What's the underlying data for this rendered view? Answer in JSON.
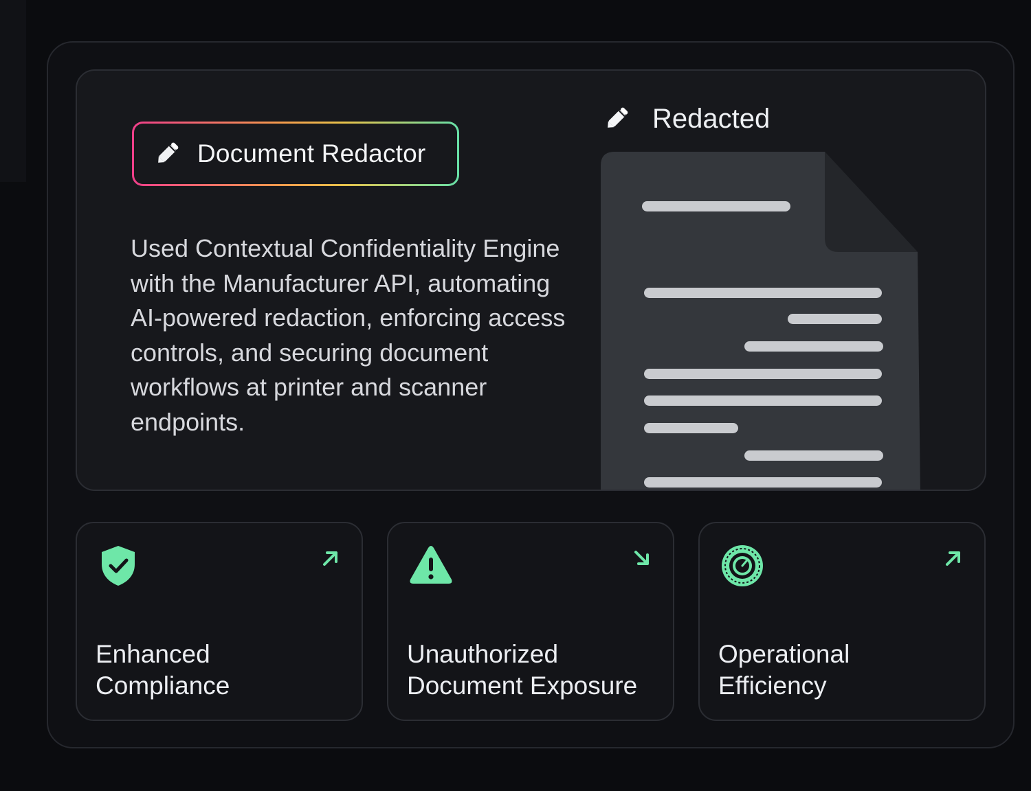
{
  "colors": {
    "background": "#0b0c0f",
    "panel": "#17181c",
    "accent_green": "#6ee7a8",
    "badge_gradient": [
      "#ef3f8a",
      "#f59a4c",
      "#e7c24b",
      "#67e0a8"
    ],
    "document": "#34373c",
    "redaction_bar": "#c9cbcf"
  },
  "hero": {
    "badge": {
      "icon": "pencil-icon",
      "label": "Document Redactor"
    },
    "description": "Used Contextual Confidentiality Engine with the Manufacturer API, automating AI-powered redaction, enforcing access controls, and securing document workflows at printer and scanner endpoints.",
    "redacted": {
      "icon": "pencil-icon",
      "label": "Redacted"
    }
  },
  "cards": [
    {
      "icon": "shield-check-icon",
      "trend": "arrow-up-right-icon",
      "title": "Enhanced\nCompliance"
    },
    {
      "icon": "warning-triangle-icon",
      "trend": "arrow-down-right-icon",
      "title": "Unauthorized\nDocument Exposure"
    },
    {
      "icon": "speedometer-icon",
      "trend": "arrow-up-right-icon",
      "title": "Operational\nEfficiency"
    }
  ]
}
